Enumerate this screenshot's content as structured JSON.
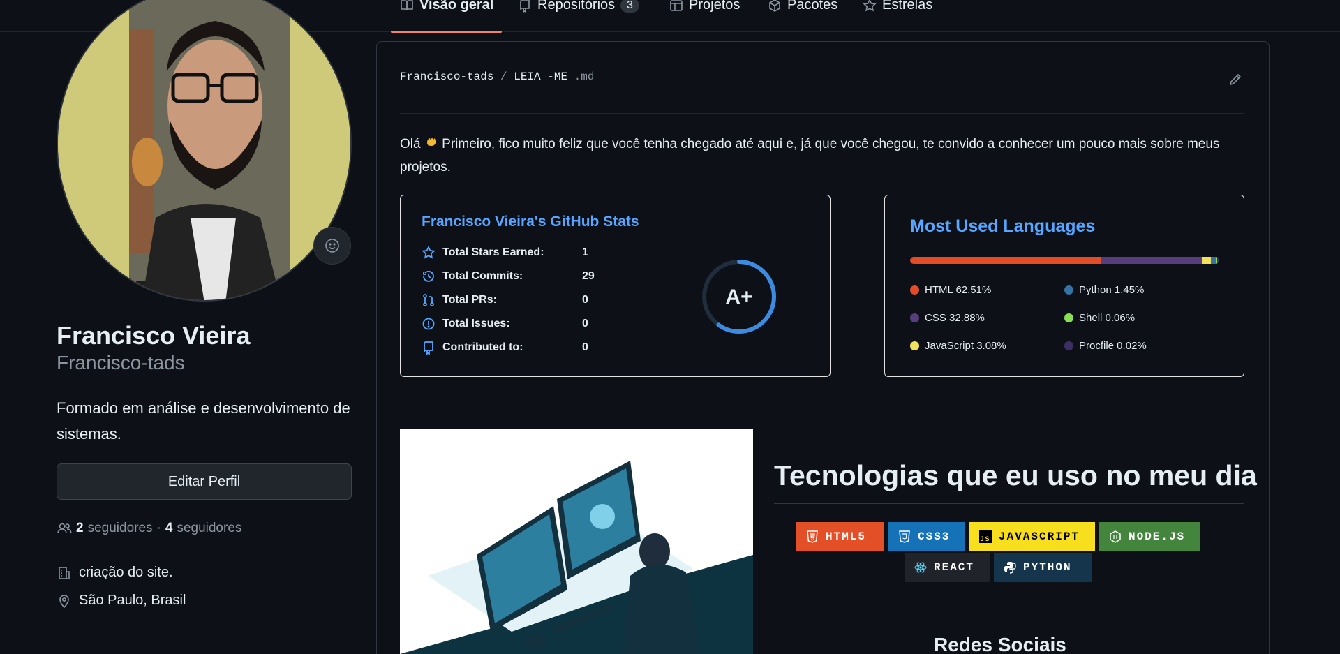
{
  "tabs": [
    {
      "label": "Visão geral",
      "active": true,
      "icon": "book-icon"
    },
    {
      "label": "Repositórios",
      "count": "3",
      "icon": "repo-icon"
    },
    {
      "label": "Projetos",
      "icon": "table-icon"
    },
    {
      "label": "Pacotes",
      "icon": "package-icon"
    },
    {
      "label": "Estrelas",
      "icon": "star-icon"
    }
  ],
  "profile": {
    "name": "Francisco Vieira",
    "login": "Francisco-tads",
    "bio": "Formado em análise e desenvolvimento de sistemas.",
    "edit_label": "Editar Perfil",
    "followers_count": "2",
    "followers_label": "seguidores",
    "following_count": "4",
    "following_label": "seguidores",
    "company": "criação do site.",
    "location": "São Paulo, Brasil"
  },
  "readme": {
    "owner": "Francisco-tads",
    "separator": "/",
    "file": "LEIA -ME",
    "ext": ".md",
    "intro_prefix": "Olá",
    "intro_text": "Primeiro, fico muito feliz que você tenha chegado até aqui e, já que você chegou, te convido a conhecer um pouco mais sobre meus projetos."
  },
  "stats_card": {
    "title": "Francisco Vieira's GitHub Stats",
    "rows": [
      {
        "label": "Total Stars Earned:",
        "value": "1",
        "icon": "star-icon"
      },
      {
        "label": "Total Commits:",
        "value": "29",
        "icon": "history-icon"
      },
      {
        "label": "Total PRs:",
        "value": "0",
        "icon": "pull-request-icon"
      },
      {
        "label": "Total Issues:",
        "value": "0",
        "icon": "issue-icon"
      },
      {
        "label": "Contributed to:",
        "value": "0",
        "icon": "repo-icon"
      }
    ],
    "grade": "A+",
    "grade_progress": 0.6,
    "ring_color": "#3d8be0"
  },
  "lang_card": {
    "title": "Most Used Languages",
    "languages": [
      {
        "label": "HTML 62.51%",
        "percent": 62.51,
        "color": "#e34c26"
      },
      {
        "label": "Python 1.45%",
        "percent": 1.45,
        "color": "#3572A5"
      },
      {
        "label": "CSS 32.88%",
        "percent": 32.88,
        "color": "#563d7c"
      },
      {
        "label": "Shell 0.06%",
        "percent": 0.06,
        "color": "#89e051"
      },
      {
        "label": "JavaScript 3.08%",
        "percent": 3.08,
        "color": "#f1e05a"
      },
      {
        "label": "Procfile 0.02%",
        "percent": 0.02,
        "color": "#3b2f63"
      }
    ]
  },
  "tech": {
    "title": "Tecnologias que eu uso no meu dia",
    "badges": [
      {
        "label": "HTML5",
        "bg": "#e34f26",
        "icon": "html5-icon"
      },
      {
        "label": "CSS3",
        "bg": "#1572b6",
        "icon": "css3-icon"
      },
      {
        "label": "JAVASCRIPT",
        "bg": "#f7df1e",
        "fg": "#000000",
        "icon": "javascript-icon"
      },
      {
        "label": "NODE.JS",
        "bg": "#43853d",
        "icon": "nodejs-icon"
      },
      {
        "label": "REACT",
        "bg": "#20232a",
        "fg": "#ffffff",
        "icon": "react-icon"
      },
      {
        "label": "PYTHON",
        "bg": "#14354c",
        "icon": "python-icon"
      }
    ],
    "social_title": "Redes Sociais"
  }
}
